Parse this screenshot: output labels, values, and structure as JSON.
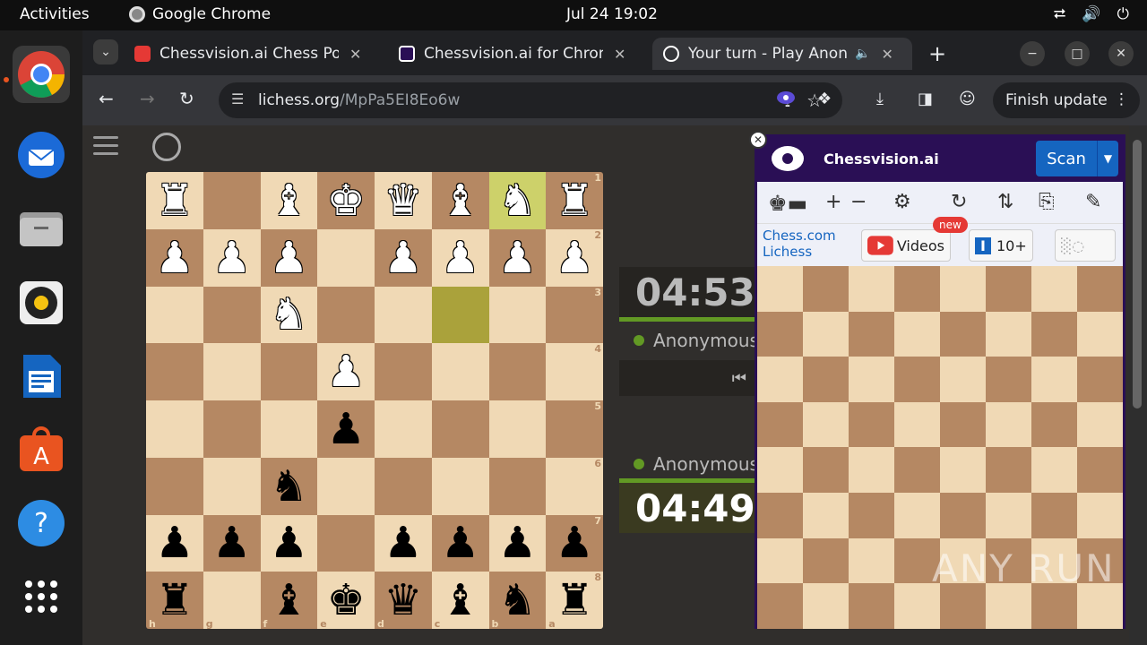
{
  "topbar": {
    "activities": "Activities",
    "app_name": "Google Chrome",
    "clock": "Jul 24  19:02",
    "tray": [
      "network-icon",
      "volume-icon",
      "power-icon"
    ]
  },
  "dock": {
    "items": [
      "chrome",
      "thunderbird",
      "files",
      "rhythmbox",
      "writer",
      "app-center",
      "help",
      "app-grid"
    ]
  },
  "tabs": [
    {
      "title": "Chessvision.ai Chess Pos",
      "favicon_color": "#e53935"
    },
    {
      "title": "Chessvision.ai for Chron",
      "favicon_color": "#2a0f55"
    },
    {
      "title": "Your turn - Play Anon",
      "favicon_color": "#ffffff",
      "active": true
    }
  ],
  "toolbar": {
    "url_host": "lichess.org",
    "url_path": "/MpPa5EI8Eo6w",
    "finish_update": "Finish update"
  },
  "board": {
    "orientation": "black",
    "rows": [
      [
        "wR",
        "",
        "wB",
        "wK",
        "wQ",
        "wB",
        "wN",
        "wR"
      ],
      [
        "wP",
        "wP",
        "wP",
        "",
        "wP",
        "wP",
        "wP",
        "wP"
      ],
      [
        "",
        "",
        "wN",
        "",
        "",
        "",
        "",
        ""
      ],
      [
        "",
        "",
        "",
        "wP",
        "",
        "",
        "",
        ""
      ],
      [
        "",
        "",
        "",
        "bP",
        "",
        "",
        "",
        ""
      ],
      [
        "",
        "",
        "bN",
        "",
        "",
        "",
        "",
        ""
      ],
      [
        "bP",
        "bP",
        "bP",
        "",
        "bP",
        "bP",
        "bP",
        "bP"
      ],
      [
        "bR",
        "",
        "bB",
        "bK",
        "bQ",
        "bB",
        "bN",
        "bR"
      ]
    ],
    "rank_labels": [
      "1",
      "2",
      "3",
      "4",
      "5",
      "6",
      "7",
      "8"
    ],
    "file_labels": [
      "h",
      "g",
      "f",
      "e",
      "d",
      "c",
      "b",
      "a"
    ],
    "highlight": [
      [
        0,
        6
      ],
      [
        2,
        5
      ]
    ]
  },
  "clocks": {
    "top_time": "04:53",
    "top_player": "Anonymous",
    "bottom_player": "Anonymous",
    "bottom_time": "04:49",
    "nav_icon": "first-move-icon"
  },
  "extension": {
    "title": "Chessvision.ai",
    "scan": "Scan",
    "links": [
      "Chess.com",
      "Lichess"
    ],
    "videos": "Videos",
    "new_badge": "new",
    "count": "10+"
  },
  "watermark": "ANY RUN"
}
